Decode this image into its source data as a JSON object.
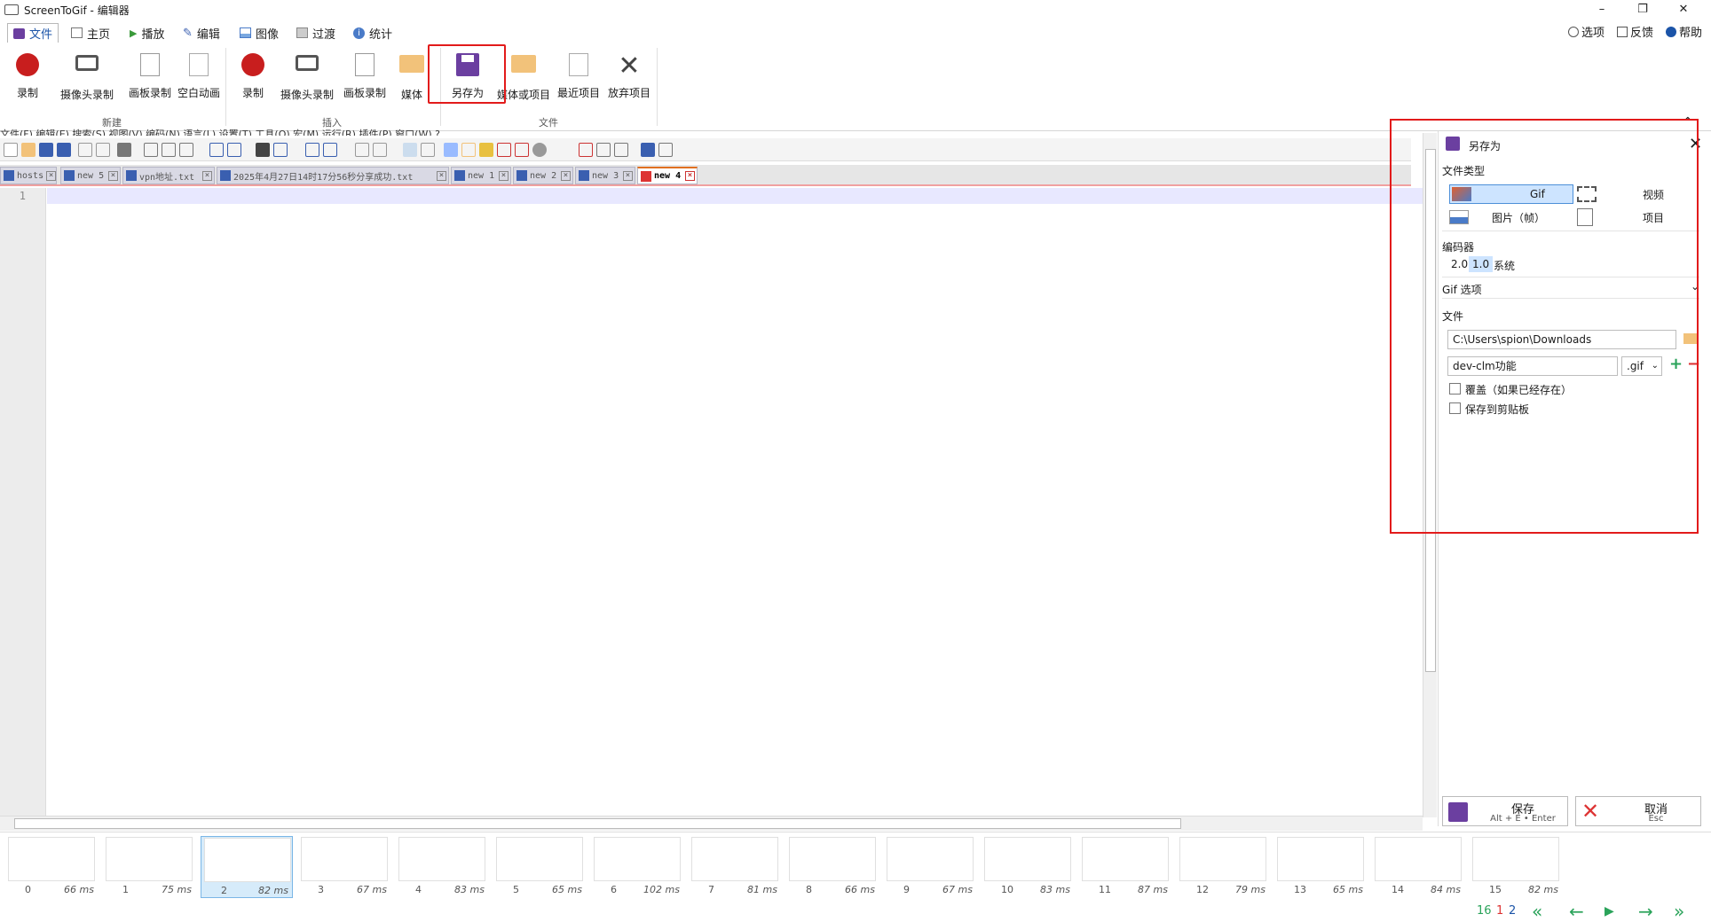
{
  "window": {
    "title": "ScreenToGif - 编辑器",
    "minimize": "–",
    "maximize": "❐",
    "close": "✕"
  },
  "menu_tabs": [
    {
      "label": "文件",
      "icon": "save-icon"
    },
    {
      "label": "主页",
      "icon": "home-icon"
    },
    {
      "label": "播放",
      "icon": "play-icon"
    },
    {
      "label": "编辑",
      "icon": "pencil-icon"
    },
    {
      "label": "图像",
      "icon": "image-icon"
    },
    {
      "label": "过渡",
      "icon": "transition-icon"
    },
    {
      "label": "统计",
      "icon": "info-icon"
    }
  ],
  "right_links": {
    "options": "选项",
    "feedback": "反馈",
    "help": "帮助"
  },
  "ribbon": {
    "new_group": "新建",
    "insert_group": "插入",
    "file_group": "文件",
    "new_buttons": [
      "录制",
      "摄像头录制",
      "画板录制",
      "空白动画"
    ],
    "insert_buttons": [
      "录制",
      "摄像头录制",
      "画板录制",
      "媒体"
    ],
    "file_buttons": [
      "另存为",
      "媒体或项目",
      "最近项目",
      "放弃项目"
    ]
  },
  "notepad": {
    "menu_text": "文件(F)   编辑(E)   搜索(S)   视图(V)   编码(N)   语言(L)   设置(T)   工具(O)   宏(M)   运行(R)   插件(P)   窗口(W)   ?",
    "tabs": [
      {
        "label": "hosts",
        "active": false
      },
      {
        "label": "new 5",
        "active": false
      },
      {
        "label": "vpn地址.txt",
        "active": false
      },
      {
        "label": "2025年4月27日14时17分56秒分享成功.txt",
        "active": false
      },
      {
        "label": "new 1",
        "active": false
      },
      {
        "label": "new 2",
        "active": false
      },
      {
        "label": "new 3",
        "active": false
      },
      {
        "label": "new 4",
        "active": true
      }
    ],
    "line_number": "1"
  },
  "save_panel": {
    "title": "另存为",
    "file_type_label": "文件类型",
    "types": {
      "gif": "Gif",
      "video": "视频",
      "images": "图片（帧）",
      "project": "项目"
    },
    "encoder_label": "编码器",
    "encoders": [
      "2.0",
      "1.0",
      "系统"
    ],
    "gif_options_label": "Gif 选项",
    "file_label": "文件",
    "folder": "C:\\Users\\spion\\Downloads",
    "filename": "dev-clm功能",
    "extension": ".gif",
    "overwrite": "覆盖（如果已经存在）",
    "clipboard": "保存到剪贴板",
    "save_label": "保存",
    "save_hint": "Alt + E • Enter",
    "cancel_label": "取消",
    "cancel_hint": "Esc"
  },
  "frames": [
    {
      "n": "0",
      "ms": "66 ms"
    },
    {
      "n": "1",
      "ms": "75 ms"
    },
    {
      "n": "2",
      "ms": "82 ms"
    },
    {
      "n": "3",
      "ms": "67 ms"
    },
    {
      "n": "4",
      "ms": "83 ms"
    },
    {
      "n": "5",
      "ms": "65 ms"
    },
    {
      "n": "6",
      "ms": "102 ms"
    },
    {
      "n": "7",
      "ms": "81 ms"
    },
    {
      "n": "8",
      "ms": "66 ms"
    },
    {
      "n": "9",
      "ms": "67 ms"
    },
    {
      "n": "10",
      "ms": "83 ms"
    },
    {
      "n": "11",
      "ms": "87 ms"
    },
    {
      "n": "12",
      "ms": "79 ms"
    },
    {
      "n": "13",
      "ms": "65 ms"
    },
    {
      "n": "14",
      "ms": "84 ms"
    },
    {
      "n": "15",
      "ms": "82 ms"
    }
  ],
  "status": {
    "total": "16",
    "selected": "1",
    "current": "2"
  },
  "colors": {
    "accent": "#1b54a8",
    "highlight": "#e21b1b",
    "selection": "#cde4ff",
    "nav": "#2aa35a"
  }
}
